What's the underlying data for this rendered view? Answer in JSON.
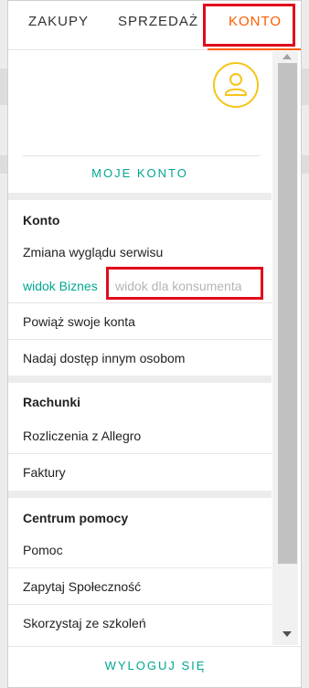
{
  "tabs": [
    {
      "label": "ZAKUPY"
    },
    {
      "label": "SPRZEDAŻ"
    },
    {
      "label": "KONTO"
    }
  ],
  "account": {
    "avatar_icon": "user-icon",
    "my_account_label": "MOJE KONTO"
  },
  "sections": {
    "konto": {
      "title": "Konto",
      "change_look_label": "Zmiana wyglądu serwisu",
      "view_business": "widok Biznes",
      "view_consumer": "widok dla konsumenta",
      "link_accounts": "Powiąż swoje konta",
      "grant_access": "Nadaj dostęp innym osobom"
    },
    "rachunki": {
      "title": "Rachunki",
      "settlements": "Rozliczenia z Allegro",
      "invoices": "Faktury"
    },
    "centrum": {
      "title": "Centrum pomocy",
      "help": "Pomoc",
      "ask_community": "Zapytaj Społeczność",
      "trainings": "Skorzystaj ze szkoleń"
    }
  },
  "footer": {
    "logout_label": "WYLOGUJ SIĘ"
  },
  "colors": {
    "accent": "#00a790",
    "active_tab": "#ff5a00",
    "highlight": "#e00b1c",
    "avatar_ring": "#f5c518"
  }
}
